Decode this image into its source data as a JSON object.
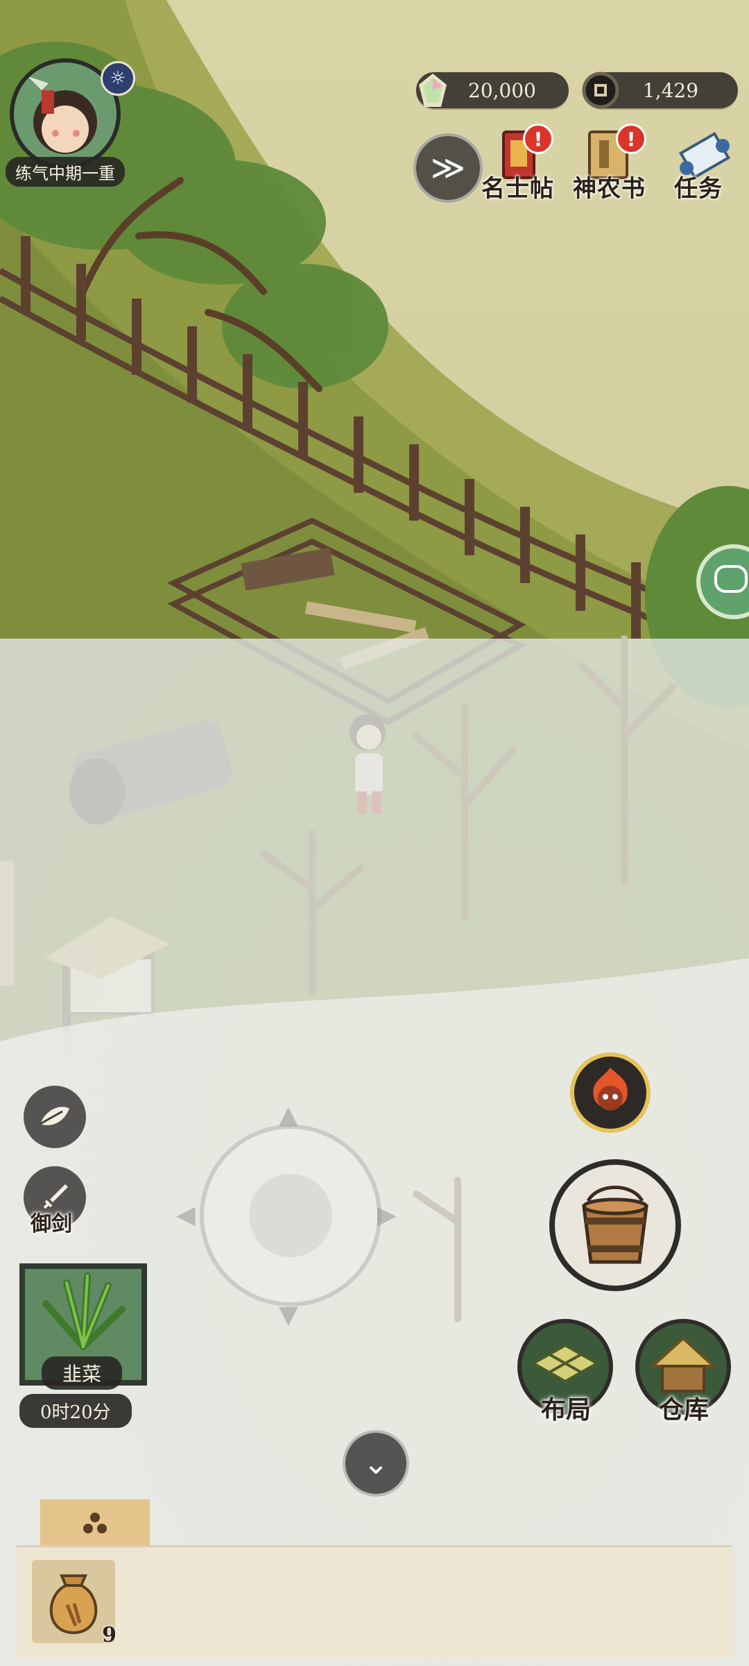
{
  "player": {
    "realm": "练气中期一重",
    "settings_icon": "sun-gear-icon",
    "avatar_icon": "avatar-girl-icon"
  },
  "currencies": {
    "jade": {
      "value": "20,000",
      "icon": "crystal-icon"
    },
    "coins": {
      "value": "1,429",
      "icon": "copper-coin-icon"
    }
  },
  "top_menu": [
    {
      "label": "名士帖",
      "icon": "red-invitation-icon",
      "alert": "!"
    },
    {
      "label": "神农书",
      "icon": "book-icon",
      "alert": "!"
    },
    {
      "label": "任务",
      "icon": "scroll-icon"
    }
  ],
  "left_controls": {
    "leaf_icon": "leaf-icon",
    "sword_label": "御剑"
  },
  "crop_card": {
    "name": "韭菜",
    "time": "0时20分",
    "icon": "chive-icon"
  },
  "actions": {
    "bucket_icon": "wooden-bucket-icon",
    "fire_icon": "fire-spirit-icon",
    "layout_label": "布局",
    "storage_label": "仓库"
  },
  "inventory": {
    "tab_icon": "stack-icon",
    "items": [
      {
        "name": "seed-bag",
        "icon": "seed-bag-icon",
        "count": "9"
      }
    ]
  },
  "colors": {
    "accent_red": "#d9352b",
    "panel_dark": "#2d2b28",
    "parchment": "#e9e3cf",
    "grass": "#8a9a45"
  }
}
